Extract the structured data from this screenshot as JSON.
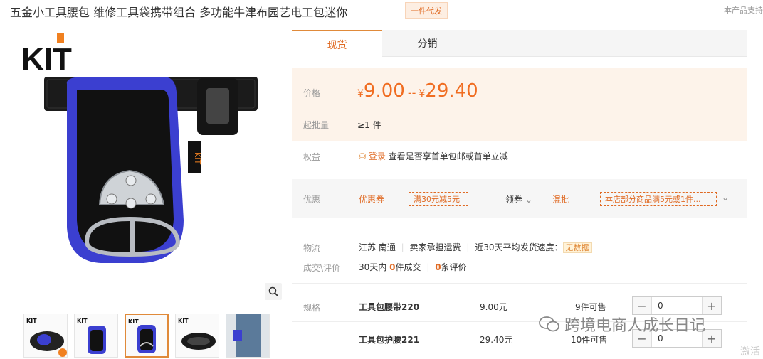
{
  "product": {
    "title": "五金小工具腰包 维修工具袋携带组合 多功能牛津布园艺电工包迷你",
    "badge": "一件代发",
    "support_text": "本产品支持"
  },
  "gallery": {
    "logo_text": "KIT",
    "thumbnails": [
      "thumb-1",
      "thumb-2",
      "thumb-3",
      "thumb-4",
      "thumb-5"
    ],
    "active_index": 2
  },
  "tabs": [
    {
      "label": "现货",
      "active": true
    },
    {
      "label": "分销",
      "active": false
    }
  ],
  "pricing": {
    "price_label": "价格",
    "currency": "¥",
    "price_low": "9.00",
    "price_sep": "--",
    "price_high": "29.40",
    "min_label": "起批量",
    "min_value": "≥1 件"
  },
  "benefits": {
    "label": "权益",
    "login_text": "登录",
    "desc": "查看是否享首单包邮或首单立减"
  },
  "promo": {
    "label": "优惠",
    "coupon_label": "优惠券",
    "coupon": "满30元减5元",
    "claim": "领券",
    "mix_label": "混批",
    "mix_desc": "本店部分商品满5元或1件..."
  },
  "logistics": {
    "label": "物流",
    "route": "江苏 南通",
    "freight": "卖家承担运费",
    "speed_label": "近30天平均发货速度：",
    "speed_value": "无数据"
  },
  "deals": {
    "label": "成交\\评价",
    "days": "30天内",
    "count": "0",
    "count_suffix": "件成交",
    "reviews": "0",
    "reviews_suffix": "条评价"
  },
  "specs": {
    "label": "规格",
    "rows": [
      {
        "name": "工具包腰带220",
        "price": "9.00元",
        "stock": "9件可售",
        "qty": "0"
      },
      {
        "name": "工具包护腰221",
        "price": "29.40元",
        "stock": "10件可售",
        "qty": "0"
      }
    ]
  },
  "overlay": {
    "watermark": "跨境电商人成长日记",
    "activate": "激活"
  },
  "colors": {
    "accent": "#e06a23",
    "price": "#f06d22",
    "price_bg": "#fdf3ea",
    "bag_blue": "#3b3fd0"
  }
}
